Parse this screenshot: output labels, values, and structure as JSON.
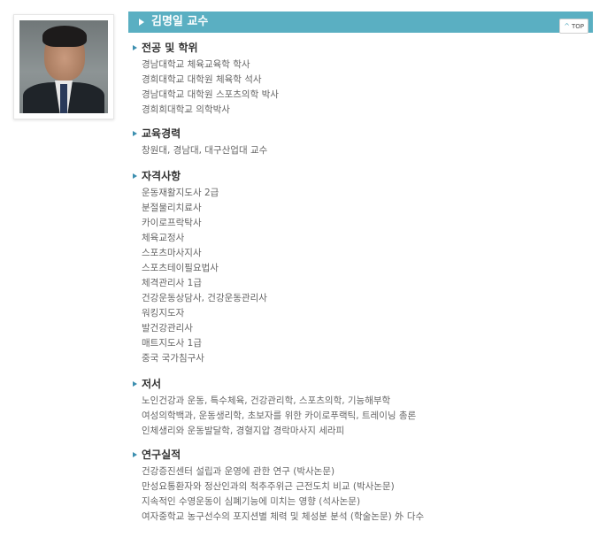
{
  "profile": {
    "name": "김명일 교수",
    "top_label": "TOP"
  },
  "sections": [
    {
      "title": "전공 및 학위",
      "items": [
        "경남대학교 체육교육학 학사",
        "경희대학교 대학원 체육학 석사",
        "경남대학교 대학원 스포츠의학 박사",
        "경희희대학교 의학박사"
      ]
    },
    {
      "title": "교육경력",
      "items": [
        "창원대, 경남대, 대구산업대 교수"
      ]
    },
    {
      "title": "자격사항",
      "items": [
        "운동재활지도사 2급",
        "분절물리치료사",
        "카이로프락탁사",
        "체육교정사",
        "스포츠마사지사",
        "스포츠테이필요법사",
        "체격관리사 1급",
        "건강운동상담사, 건강운동관리사",
        "워킹지도자",
        "발건강관리사",
        "매트지도사 1급",
        "중국 국가침구사"
      ]
    },
    {
      "title": "저서",
      "items": [
        "노인건강과 운동, 특수체육, 건강관리학, 스포츠의학, 기능해부학",
        "여성의학백과, 운동생리학, 초보자를 위한 카이로푸랙틱, 트레이닝 총론",
        "인체생리와 운동발달학, 경혈지압 경락마사지 세라피"
      ]
    },
    {
      "title": "연구실적",
      "items": [
        "건강증진센터 설립과 운영에 관한 연구 (박사논문)",
        "만성요통환자와 정산인과의 척추주위근 근전도치 비교 (박사논문)",
        "지속적인 수영운동이 심폐기능에 미치는 영향 (석사논문)",
        "여자중학교 농구선수의 포지션별 체력 및 체성분 분석 (학술논문) 外 다수"
      ]
    }
  ],
  "colors": {
    "title_bar": "#5aafc2",
    "bullet": "#3c8fb0"
  },
  "icons": {
    "photo": "person-portrait",
    "bullet": "triangle-right-icon",
    "top": "chevron-up-icon"
  }
}
